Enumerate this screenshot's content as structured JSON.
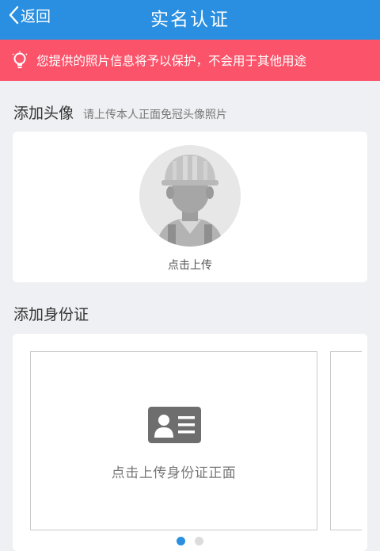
{
  "header": {
    "back_label": "返回",
    "title": "实名认证",
    "bg_color": "#2a8fe0"
  },
  "notice": {
    "icon": "lightbulb-icon",
    "text": "您提供的照片信息将予以保护，不会用于其他用途",
    "bg_color": "#fb536a"
  },
  "avatar_section": {
    "heading": "添加头像",
    "hint": "请上传本人正面免冠头像照片",
    "placeholder_icon": "worker-helmet-avatar-icon",
    "upload_label": "点击上传"
  },
  "id_section": {
    "heading": "添加身份证",
    "card_icon": "id-card-icon",
    "upload_label": "点击上传身份证正面",
    "pager": {
      "pages": 2,
      "active_index": 0
    }
  }
}
